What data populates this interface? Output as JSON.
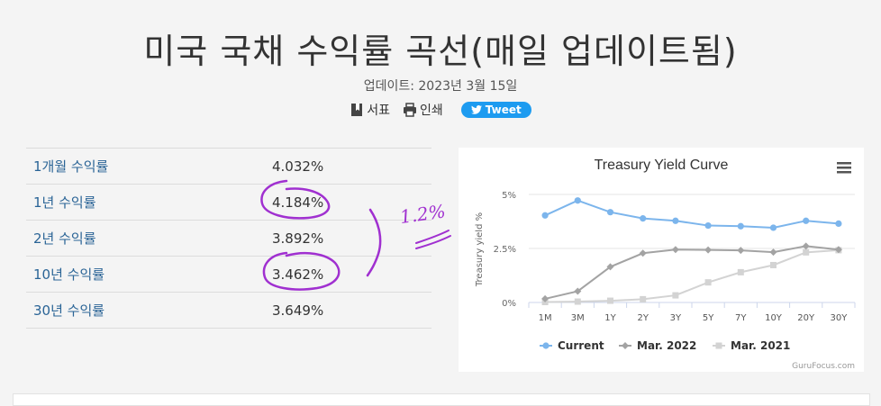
{
  "page": {
    "title": "미국 국채 수익률 곡선(매일 업데이트됨)",
    "updated": "업데이트: 2023년 3월 15일",
    "actions": {
      "bookmark_label": "서표",
      "print_label": "인쇄",
      "tweet_label": "Tweet"
    }
  },
  "yields_table": {
    "rows": [
      {
        "label": "1개월 수익률",
        "value": "4.032%"
      },
      {
        "label": "1년 수익률",
        "value": "4.184%"
      },
      {
        "label": "2년 수익률",
        "value": "3.892%"
      },
      {
        "label": "10년 수익률",
        "value": "3.462%"
      },
      {
        "label": "30년 수익률",
        "value": "3.649%"
      }
    ]
  },
  "annotations": {
    "handwritten_note": "1.2%",
    "color": "#a030d0"
  },
  "chart_data": {
    "type": "line",
    "title": "Treasury Yield Curve",
    "ylabel": "Treasury yield %",
    "xlabel": "",
    "categories": [
      "1M",
      "3M",
      "1Y",
      "2Y",
      "3Y",
      "5Y",
      "7Y",
      "10Y",
      "20Y",
      "30Y"
    ],
    "ylim": [
      0,
      5
    ],
    "yticks": [
      {
        "v": 0,
        "label": "0%"
      },
      {
        "v": 2.5,
        "label": "2.5%"
      },
      {
        "v": 5,
        "label": "5%"
      }
    ],
    "grid": true,
    "legend_position": "bottom",
    "credit": "GuruFocus.com",
    "series": [
      {
        "name": "Current",
        "color": "#7cb5ec",
        "marker": "circle",
        "values": [
          4.03,
          4.72,
          4.18,
          3.89,
          3.78,
          3.56,
          3.53,
          3.46,
          3.78,
          3.65
        ]
      },
      {
        "name": "Mar. 2022",
        "color": "#a3a3a3",
        "marker": "diamond",
        "values": [
          0.17,
          0.52,
          1.65,
          2.28,
          2.45,
          2.43,
          2.41,
          2.33,
          2.61,
          2.45
        ]
      },
      {
        "name": "Mar. 2021",
        "color": "#d3d3d3",
        "marker": "square",
        "values": [
          0.02,
          0.04,
          0.08,
          0.15,
          0.33,
          0.93,
          1.4,
          1.73,
          2.32,
          2.42
        ]
      }
    ]
  }
}
